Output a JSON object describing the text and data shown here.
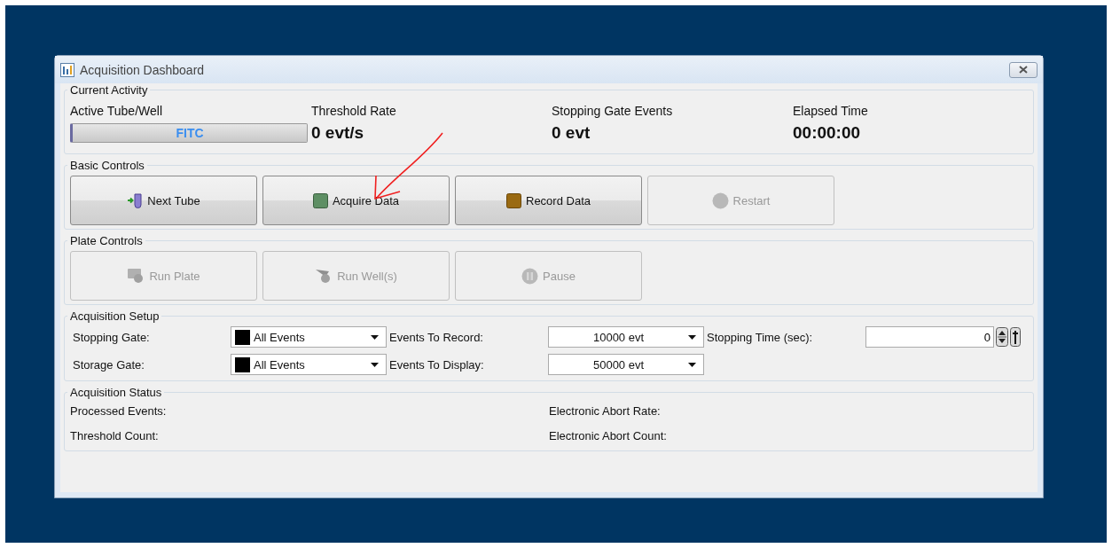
{
  "window": {
    "title": "Acquisition Dashboard"
  },
  "current_activity": {
    "title": "Current Activity",
    "items": [
      {
        "label": "Active Tube/Well",
        "value": "FITC",
        "kind": "tube"
      },
      {
        "label": "Threshold Rate",
        "value": "0 evt/s",
        "kind": "reading"
      },
      {
        "label": "Stopping Gate Events",
        "value": "0 evt",
        "kind": "reading"
      },
      {
        "label": "Elapsed Time",
        "value": "00:00:00",
        "kind": "reading"
      }
    ]
  },
  "basic_controls": {
    "title": "Basic Controls",
    "buttons": [
      {
        "label": "Next Tube",
        "disabled": false
      },
      {
        "label": "Acquire Data",
        "disabled": false
      },
      {
        "label": "Record Data",
        "disabled": false
      },
      {
        "label": "Restart",
        "disabled": true
      }
    ]
  },
  "plate_controls": {
    "title": "Plate Controls",
    "buttons": [
      {
        "label": "Run Plate",
        "disabled": true
      },
      {
        "label": "Run Well(s)",
        "disabled": true
      },
      {
        "label": "Pause",
        "disabled": true
      }
    ]
  },
  "acquisition_setup": {
    "title": "Acquisition Setup",
    "rows": [
      {
        "gate_label": "Stopping Gate:",
        "gate_value": "All Events",
        "events_label": "Events To Record:",
        "events_value": "10000 evt",
        "time_label": "Stopping Time (sec):",
        "time_value": "0"
      },
      {
        "gate_label": "Storage Gate:",
        "gate_value": "All Events",
        "events_label": "Events To Display:",
        "events_value": "50000 evt"
      }
    ]
  },
  "acquisition_status": {
    "title": "Acquisition Status",
    "left": [
      "Processed Events:",
      "Threshold Count:"
    ],
    "right": [
      "Electronic Abort Rate:",
      "Electronic Abort Count:"
    ]
  }
}
